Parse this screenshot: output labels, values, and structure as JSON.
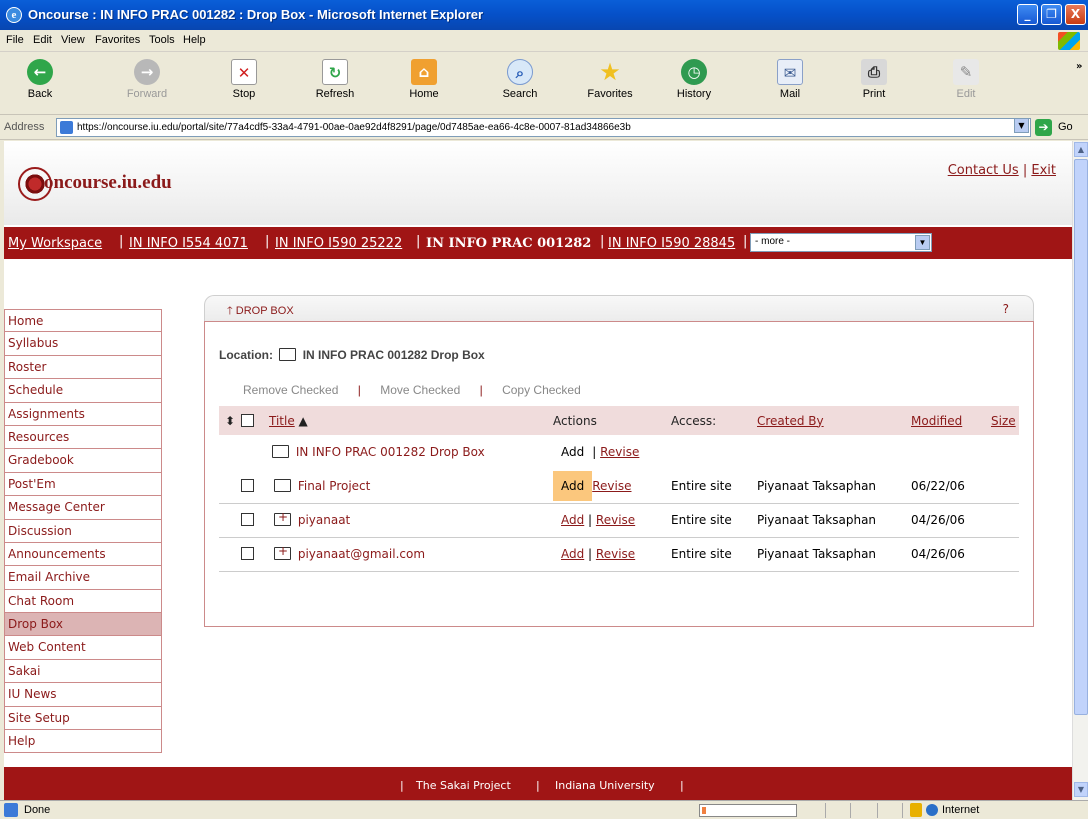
{
  "window": {
    "title": "Oncourse : IN INFO PRAC 001282 : Drop Box - Microsoft Internet Explorer",
    "minimize": "_",
    "maximize": "❐",
    "close": "X"
  },
  "menu": [
    "File",
    "Edit",
    "View",
    "Favorites",
    "Tools",
    "Help"
  ],
  "toolbar": {
    "back": "Back",
    "forward": "Forward",
    "stop": "Stop",
    "refresh": "Refresh",
    "home": "Home",
    "search": "Search",
    "favorites": "Favorites",
    "history": "History",
    "mail": "Mail",
    "print": "Print",
    "edit": "Edit",
    "more": "»"
  },
  "address": {
    "label": "Address",
    "url": "https://oncourse.iu.edu/portal/site/77a4cdf5-33a4-4791-00ae-0ae92d4f8291/page/0d7485ae-ea66-4c8e-0007-81ad34866e3b",
    "go": "Go"
  },
  "header": {
    "logo": "oncourse.iu.edu",
    "contact": "Contact Us",
    "separator": "|",
    "exit": "Exit"
  },
  "sites": {
    "tabs": [
      "My Workspace",
      "IN INFO I554 4071",
      "IN INFO I590 25222",
      "IN INFO PRAC 001282",
      "IN INFO I590 28845"
    ],
    "more": "- more -"
  },
  "tools": [
    "Home",
    "Syllabus",
    "Roster",
    "Schedule",
    "Assignments",
    "Resources",
    "Gradebook",
    "Post'Em",
    "Message Center",
    "Discussion",
    "Announcements",
    "Email Archive",
    "Chat Room",
    "Drop Box",
    "Web Content",
    "Sakai",
    "IU News",
    "Site Setup",
    "Help"
  ],
  "dropbox": {
    "title": "DROP BOX",
    "help": "?",
    "location_label": "Location:",
    "location_value": "IN INFO PRAC 001282 Drop Box",
    "actions": {
      "remove": "Remove Checked",
      "move": "Move Checked",
      "copy": "Copy Checked",
      "pipe": "|"
    },
    "columns": {
      "title": "Title",
      "actions": "Actions",
      "access": "Access:",
      "created_by": "Created By",
      "modified": "Modified",
      "size": "Size"
    },
    "root": {
      "name": "IN INFO PRAC 001282 Drop Box",
      "add": "Add",
      "revise": "Revise"
    },
    "rows": [
      {
        "name": "Final Project",
        "add": "Add",
        "revise": "Revise",
        "access": "Entire site",
        "created_by": "Piyanaat Taksaphan",
        "modified": "06/22/06"
      },
      {
        "name": "piyanaat",
        "add": "Add",
        "revise": "Revise",
        "access": "Entire site",
        "created_by": "Piyanaat Taksaphan",
        "modified": "04/26/06"
      },
      {
        "name": "piyanaat@gmail.com",
        "add": "Add",
        "revise": "Revise",
        "access": "Entire site",
        "created_by": "Piyanaat Taksaphan",
        "modified": "04/26/06"
      }
    ]
  },
  "footer": {
    "pipe": "|",
    "sakai": "The Sakai Project",
    "iu": "Indiana University"
  },
  "status": {
    "text": "Done",
    "zone": "Internet"
  }
}
